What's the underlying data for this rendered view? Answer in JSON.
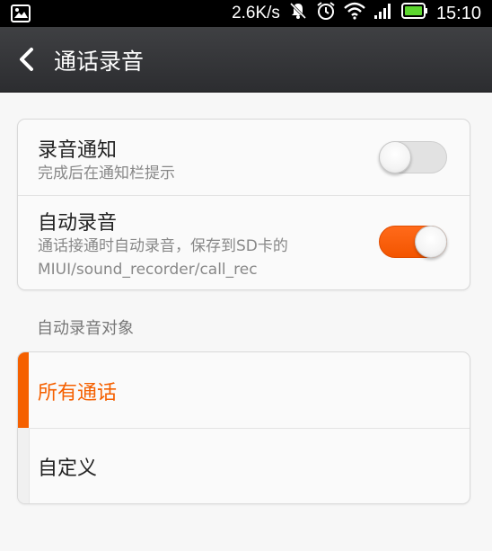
{
  "status_bar": {
    "network_speed": "2.6K/s",
    "time": "15:10",
    "icons": [
      "image-icon",
      "mute-notification-icon",
      "alarm-icon",
      "wifi-icon",
      "signal-icon",
      "battery-icon"
    ]
  },
  "header": {
    "title": "通话录音"
  },
  "settings": {
    "recording_notification": {
      "title": "录音通知",
      "subtitle": "完成后在通知栏提示",
      "enabled": false
    },
    "auto_record": {
      "title": "自动录音",
      "subtitle_line1": "通话接通时自动录音，保存到SD卡的",
      "subtitle_line2": "MIUI/sound_recorder/call_rec",
      "enabled": true
    }
  },
  "auto_record_target": {
    "section_label": "自动录音对象",
    "options": [
      {
        "label": "所有通话",
        "selected": true
      },
      {
        "label": "自定义",
        "selected": false
      }
    ]
  },
  "colors": {
    "accent": "#f56000",
    "titlebar": "#36373a",
    "background": "#f7f7f7"
  }
}
